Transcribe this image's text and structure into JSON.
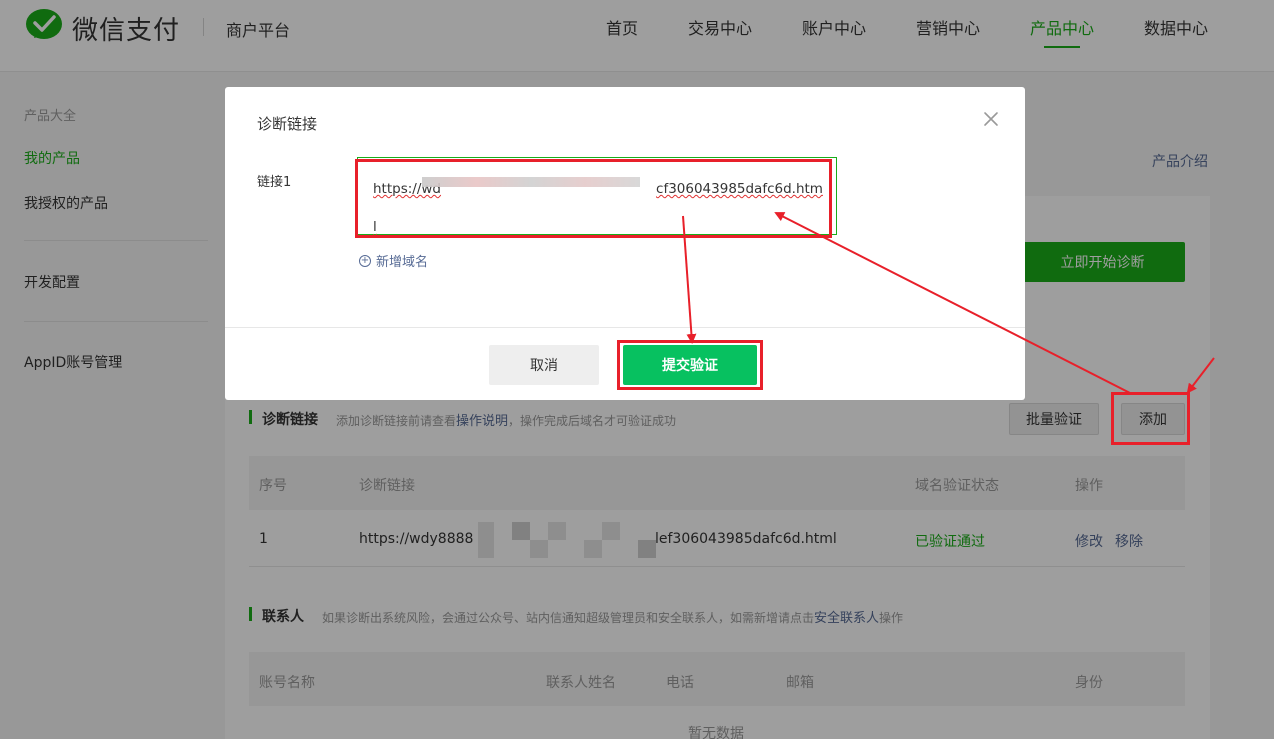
{
  "header": {
    "brand": "微信支付",
    "platform": "商户平台",
    "nav": [
      "首页",
      "交易中心",
      "账户中心",
      "营销中心",
      "产品中心",
      "数据中心"
    ],
    "active_nav": "产品中心"
  },
  "sidebar": {
    "group": "产品大全",
    "items": [
      "我的产品",
      "我授权的产品",
      "开发配置",
      "AppID账号管理"
    ]
  },
  "main": {
    "intro_link": "产品介绍",
    "start_button": "立即开始诊断",
    "diag_section": {
      "title": "诊断链接",
      "desc_prefix": "添加诊断链接前请查看",
      "desc_link": "操作说明",
      "desc_suffix": "，操作完成后域名才可验证成功",
      "batch_button": "批量验证",
      "add_button": "添加",
      "columns": [
        "序号",
        "诊断链接",
        "域名验证状态",
        "操作"
      ],
      "row": {
        "index": "1",
        "link_start": "https://wdy8888",
        "link_end": "lef306043985dafc6d.html",
        "status": "已验证通过",
        "edit": "修改",
        "remove": "移除"
      }
    },
    "contact_section": {
      "title": "联系人",
      "desc_prefix": "如果诊断出系统风险，会通过公众号、站内信通知超级管理员和安全联系人，如需新增请点击",
      "desc_link": "安全联系人",
      "desc_suffix": "操作",
      "columns": [
        "账号名称",
        "联系人姓名",
        "电话",
        "邮箱",
        "身份"
      ],
      "empty": "暂无数据"
    }
  },
  "dialog": {
    "title": "诊断链接",
    "field_label": "链接1",
    "url_start": "https://wd",
    "url_end": "cf306043985dafc6d.html",
    "add_domain": "新增域名",
    "cancel": "取消",
    "submit": "提交验证"
  },
  "colors": {
    "brand_green": "#1aad19",
    "submit_green": "#07c160",
    "link_blue": "#576b95",
    "annotation_red": "#e8202a"
  }
}
